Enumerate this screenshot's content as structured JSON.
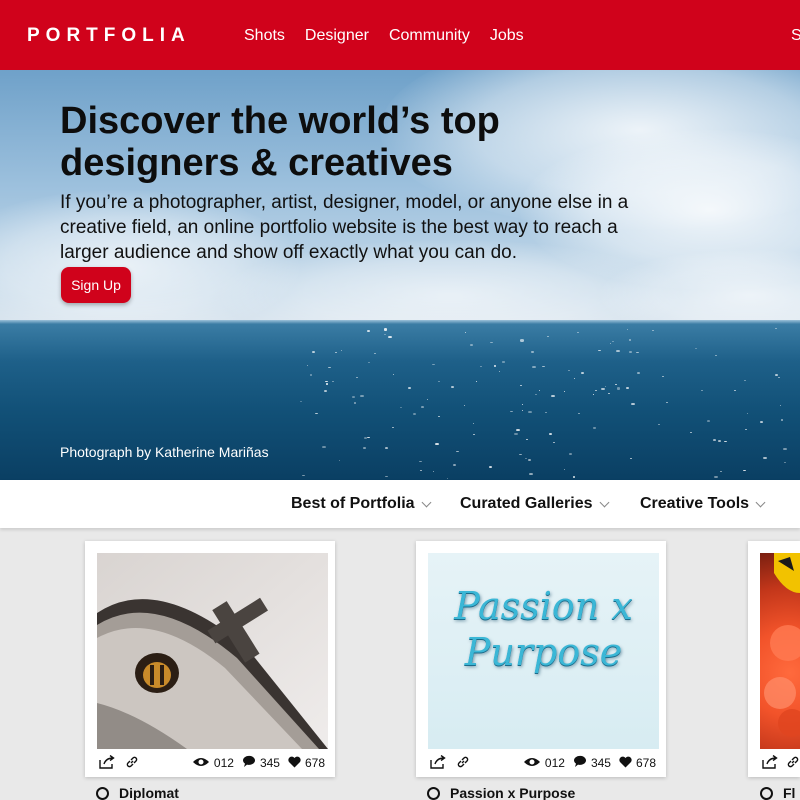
{
  "nav": {
    "logo": "PORTFOLIA",
    "links": [
      "Shots",
      "Designer",
      "Community",
      "Jobs"
    ],
    "right_partial": "S"
  },
  "hero": {
    "title": "Discover the world’s top designers & creatives",
    "description": "If you’re a photographer, artist, designer, model, or anyone else in a creative field, an online portfolio website is the best way to reach a larger audience and show off exactly what you can do.",
    "cta": "Sign Up",
    "credit": "Photograph by Katherine Mariñas"
  },
  "subnav": {
    "items": [
      "Best of Portfolia",
      "Curated Galleries",
      "Creative Tools"
    ]
  },
  "cards": [
    {
      "title": "Diplomat",
      "views": "012",
      "comments": "345",
      "likes": "678"
    },
    {
      "title": "Passion x Purpose",
      "image_text": "Passion x Purpose",
      "views": "012",
      "comments": "345",
      "likes": "678"
    },
    {
      "title": "Fl"
    }
  ],
  "colors": {
    "brand": "#d0021b",
    "background": "#e9e9e9"
  },
  "icons": [
    "share-icon",
    "link-icon",
    "eye-icon",
    "comment-icon",
    "heart-icon",
    "chevron-down-icon",
    "circle-icon"
  ]
}
